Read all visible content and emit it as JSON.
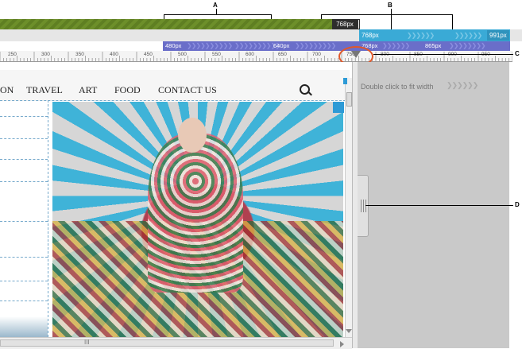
{
  "breakpoints": {
    "current": "768px",
    "blue_labels": [
      "768px",
      "991px"
    ],
    "purple_labels": [
      "480px",
      "640px",
      "768px",
      "865px"
    ]
  },
  "ruler": {
    "ticks": [
      "250",
      "300",
      "350",
      "400",
      "450",
      "500",
      "550",
      "600",
      "650",
      "700",
      "750",
      "800",
      "850",
      "900",
      "950"
    ]
  },
  "callouts": {
    "a": "A",
    "b": "B",
    "c": "C",
    "d": "D"
  },
  "nav": {
    "items": [
      "ON",
      "TRAVEL",
      "ART",
      "FOOD",
      "CONTACT US"
    ]
  },
  "panel": {
    "hint": "Double click to fit width"
  },
  "scroll": {
    "grip": "III"
  },
  "colors": {
    "green": "#6d8f2a",
    "blue": "#3aaad6",
    "purple": "#6a6ec9",
    "annotation": "#e0582a"
  }
}
